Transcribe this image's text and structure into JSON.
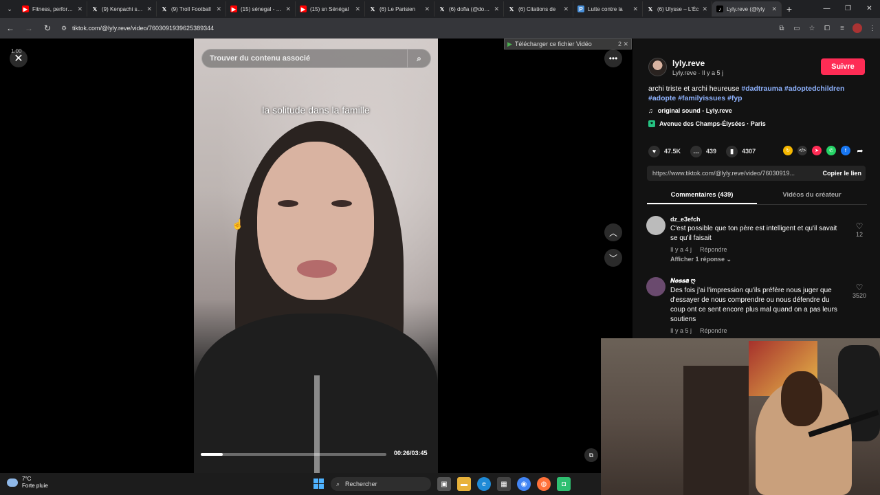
{
  "browser": {
    "tabs": [
      {
        "title": "Fitness, performance",
        "icon": "youtube-icon",
        "active": false
      },
      {
        "title": "(9) Kenpachi sur X",
        "icon": "x-icon",
        "active": false
      },
      {
        "title": "(9) Troll Football",
        "icon": "x-icon",
        "active": false
      },
      {
        "title": "(15) sénegal - YouTube",
        "icon": "youtube-icon",
        "active": false
      },
      {
        "title": "(15) sn Sénégal",
        "icon": "youtube-icon",
        "active": false
      },
      {
        "title": "(6) Le Parisien",
        "icon": "x-icon",
        "active": false
      },
      {
        "title": "(6) dofla (@dofla)",
        "icon": "x-icon",
        "active": false
      },
      {
        "title": "(6) Citations de",
        "icon": "x-icon",
        "active": false
      },
      {
        "title": "Lutte contre la",
        "icon": "p-icon",
        "active": false
      },
      {
        "title": "(6) Ulysse – L'Éc",
        "icon": "x-icon",
        "active": false
      },
      {
        "title": "Lyly.reve (@lyly",
        "icon": "tiktok-icon",
        "active": true
      }
    ],
    "url": "tiktok.com/@lyly.reve/video/7603091939625389344"
  },
  "player": {
    "search_placeholder": "Trouver du contenu associé",
    "caption": "la solitude dans la famille",
    "timecode": "00:26/03:45",
    "progress_fraction": 0.12,
    "download_label": "Télécharger ce fichier Vidéo",
    "download_extra": "2 ✕",
    "top_left_badge": "1.00"
  },
  "post": {
    "username": "lyly.reve",
    "handle_line": "Lyly.reve · Il y a 5 j",
    "follow_label": "Suivre",
    "description_text": "archi triste et archi heureuse ",
    "hashtags": [
      "#dadtrauma",
      "#adoptedchildren",
      "#adopte",
      "#familyissues",
      "#fyp"
    ],
    "sound": "original sound - Lyly.reve",
    "location": "Avenue des Champs-Élysées · Paris",
    "likes": "47.5K",
    "comments": "439",
    "saves": "4307",
    "link": "https://www.tiktok.com/@lyly.reve/video/76030919...",
    "copy_label": "Copier le lien",
    "tab_comments": "Commentaires (439)",
    "tab_creator": "Vidéos du créateur"
  },
  "comments": [
    {
      "name": "dz_e3efch",
      "text": "C'est possible que ton père est intelligent et qu'il savait se qu'il faisait",
      "time": "Il y a 4 j",
      "reply": "Répondre",
      "replies": "Afficher 1 réponse ⌄",
      "likes": "12"
    },
    {
      "name": "𝑵𝒆𝒔𝒔𝒂 ღ",
      "text": "Des fois j'ai l'impression qu'ils préfère nous juger que d'essayer de nous comprendre ou nous défendre du coup ont ce sent encore plus mal quand on a pas leurs soutiens",
      "time": "Il y a 5 j",
      "reply": "Répondre",
      "likes": "3520"
    }
  ],
  "taskbar": {
    "temp": "7°C",
    "weather": "Forte pluie",
    "search_label": "Rechercher"
  },
  "colors": {
    "accent": "#fe2c55",
    "hashtag": "#8fb3ff"
  }
}
